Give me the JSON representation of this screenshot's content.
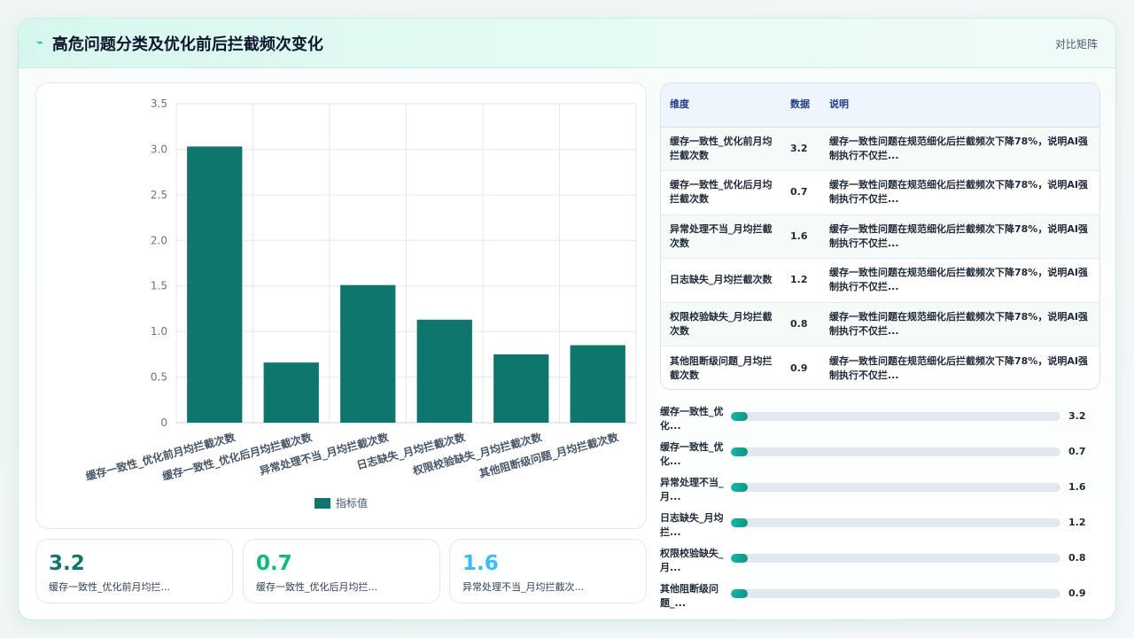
{
  "header": {
    "title": "高危问题分类及优化前后拦截频次变化",
    "title_icon": "spark-icon",
    "right_label": "对比矩阵"
  },
  "colors": {
    "accent": "#0f766e",
    "kpi": [
      "#0f766e",
      "#10b981",
      "#38bdf8"
    ]
  },
  "chart_data": {
    "type": "bar",
    "categories": [
      "缓存一致性_优化前月均拦截次数",
      "缓存一致性_优化后月均拦截次数",
      "异常处理不当_月均拦截次数",
      "日志缺失_月均拦截次数",
      "权限校验缺失_月均拦截次数",
      "其他阻断级问题_月均拦截次数"
    ],
    "series": [
      {
        "name": "指标值",
        "values": [
          3.03,
          0.66,
          1.51,
          1.13,
          0.75,
          0.85
        ],
        "color": "#0f766e"
      }
    ],
    "yticks": [
      "0",
      "0.5",
      "1.0",
      "1.5",
      "2.0",
      "2.5",
      "3.0",
      "3.5"
    ],
    "ylim": [
      0,
      3.5
    ],
    "grid": true,
    "legend": "bottom"
  },
  "kpis": [
    {
      "value": "3.2",
      "label": "缓存一致性_优化前月均拦..."
    },
    {
      "value": "0.7",
      "label": "缓存一致性_优化后月均拦..."
    },
    {
      "value": "1.6",
      "label": "异常处理不当_月均拦截次..."
    }
  ],
  "table": {
    "headers": [
      "维度",
      "数据",
      "说明"
    ],
    "rows": [
      {
        "dim": "缓存一致性_优化前月均拦截次数",
        "value": "3.2",
        "note": "缓存一致性问题在规范细化后拦截频次下降78%，说明AI强制执行不仅拦..."
      },
      {
        "dim": "缓存一致性_优化后月均拦截次数",
        "value": "0.7",
        "note": "缓存一致性问题在规范细化后拦截频次下降78%，说明AI强制执行不仅拦..."
      },
      {
        "dim": "异常处理不当_月均拦截次数",
        "value": "1.6",
        "note": "缓存一致性问题在规范细化后拦截频次下降78%，说明AI强制执行不仅拦..."
      },
      {
        "dim": "日志缺失_月均拦截次数",
        "value": "1.2",
        "note": "缓存一致性问题在规范细化后拦截频次下降78%，说明AI强制执行不仅拦..."
      },
      {
        "dim": "权限校验缺失_月均拦截次数",
        "value": "0.8",
        "note": "缓存一致性问题在规范细化后拦截频次下降78%，说明AI强制执行不仅拦..."
      },
      {
        "dim": "其他阻断级问题_月均拦截次数",
        "value": "0.9",
        "note": "缓存一致性问题在规范细化后拦截频次下降78%，说明AI强制执行不仅拦..."
      }
    ]
  },
  "progress": [
    {
      "label": "缓存一致性_优化...",
      "value": "3.2",
      "fraction": 0.02
    },
    {
      "label": "缓存一致性_优化...",
      "value": "0.7",
      "fraction": 0.02
    },
    {
      "label": "异常处理不当_月...",
      "value": "1.6",
      "fraction": 0.02
    },
    {
      "label": "日志缺失_月均拦...",
      "value": "1.2",
      "fraction": 0.02
    },
    {
      "label": "权限校验缺失_月...",
      "value": "0.8",
      "fraction": 0.02
    },
    {
      "label": "其他阻断级问题_...",
      "value": "0.9",
      "fraction": 0.02
    }
  ]
}
